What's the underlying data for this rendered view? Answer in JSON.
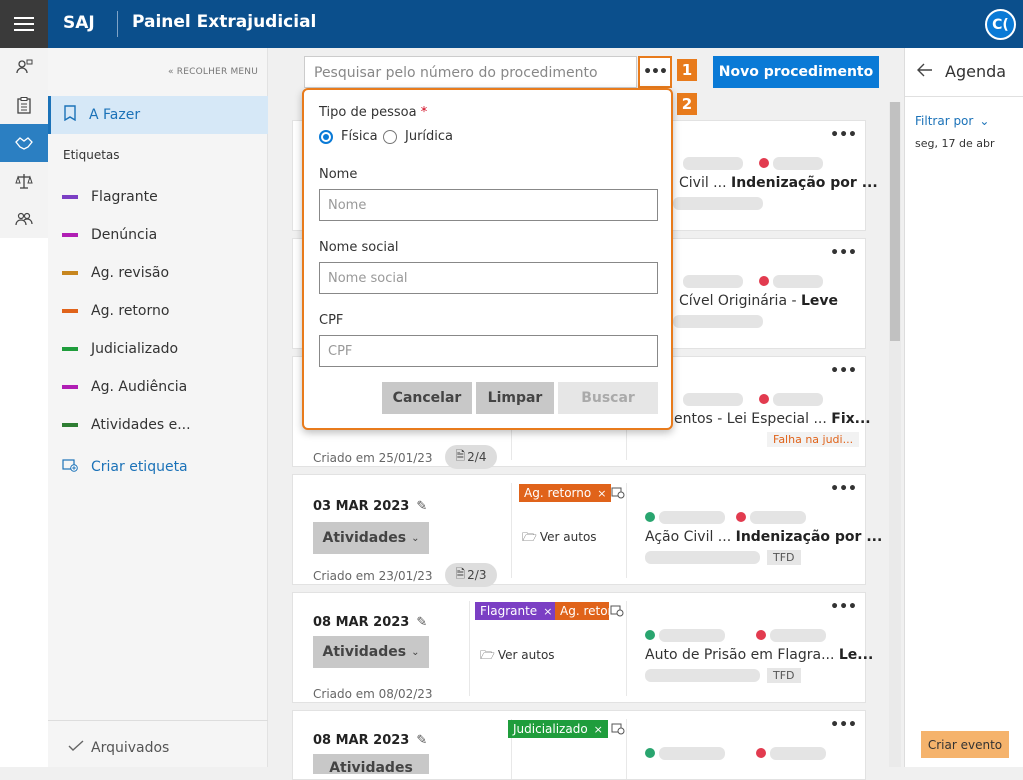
{
  "header": {
    "brand": "SAJ",
    "title": "Painel Extrajudicial",
    "avatar": "C("
  },
  "rail": {
    "icons": [
      "person-badge-icon",
      "clipboard-icon",
      "handshake-icon",
      "scales-icon",
      "group-icon"
    ],
    "active_index": 2
  },
  "sidebar": {
    "collapse_label": "« RECOLHER MENU",
    "todo_label": "A Fazer",
    "tags_title": "Etiquetas",
    "tags": [
      {
        "label": "Flagrante",
        "color": "#7b3fc4"
      },
      {
        "label": "Denúncia",
        "color": "#b01fb4"
      },
      {
        "label": "Ag. revisão",
        "color": "#c7861e"
      },
      {
        "label": "Ag. retorno",
        "color": "#e0631a"
      },
      {
        "label": "Judicializado",
        "color": "#1f9d3c"
      },
      {
        "label": "Ag. Audiência",
        "color": "#b01fb4"
      },
      {
        "label": "Atividades e...",
        "color": "#2e7d32"
      }
    ],
    "create_tag": "Criar etiqueta",
    "archived": "Arquivados"
  },
  "toolbar": {
    "search_placeholder": "Pesquisar pelo número do procedimento",
    "more": "•••",
    "new_button": "Novo procedimento",
    "callout_1": "1",
    "callout_2": "2"
  },
  "popup": {
    "person_type_label": "Tipo de pessoa",
    "required_mark": "*",
    "options": [
      "Física",
      "Jurídica"
    ],
    "selected_option": "Física",
    "name_label": "Nome",
    "name_placeholder": "Nome",
    "social_label": "Nome social",
    "social_placeholder": "Nome social",
    "cpf_label": "CPF",
    "cpf_placeholder": "CPF",
    "cancel": "Cancelar",
    "clear": "Limpar",
    "search": "Buscar"
  },
  "cards": [
    {
      "dots": "•••",
      "proc": "Civil ...",
      "proc_bold": "Indenização por ..."
    },
    {
      "dots": "•••",
      "proc": "Cível Originária - ",
      "proc_bold": "Leve"
    },
    {
      "dots": "•••",
      "created": "Criado em 25/01/23",
      "docs": "2/4",
      "proc": "entos - Lei Especial ...",
      "proc_bold": "Fix...",
      "alert": "Falha na judi..."
    },
    {
      "dots": "•••",
      "date": "03 MAR 2023",
      "activities": "Atividades",
      "created": "Criado em 23/01/23",
      "docs": "2/3",
      "tags": [
        "Ag. retorno"
      ],
      "see_files": "Ver autos",
      "proc": "Ação Civil ...",
      "proc_bold": "Indenização por ...",
      "badge": "TFD"
    },
    {
      "dots": "•••",
      "date": "08 MAR 2023",
      "activities": "Atividades",
      "created": "Criado em 08/02/23",
      "tags": [
        "Flagrante",
        "Ag. retorn"
      ],
      "see_files": "Ver autos",
      "proc": "Auto de Prisão em Flagra...",
      "proc_bold": "Le...",
      "badge": "TFD"
    },
    {
      "dots": "•••",
      "date": "08 MAR 2023",
      "activities": "Atividades",
      "tags": [
        "Judicializado"
      ]
    }
  ],
  "chip_close": "×",
  "agenda": {
    "title": "Agenda",
    "filter": "Filtrar por",
    "day": "seg, 17 de abr",
    "create_event": "Criar evento"
  }
}
